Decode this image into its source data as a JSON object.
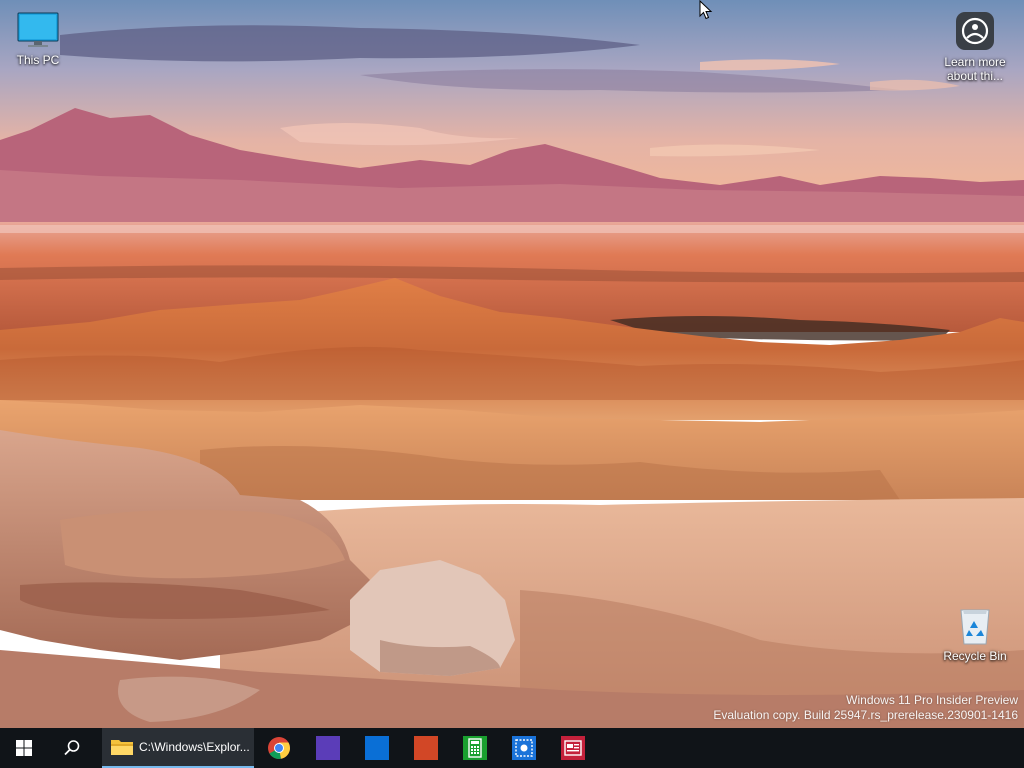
{
  "desktop": {
    "icons": {
      "this_pc": {
        "label": "This PC",
        "icon": "monitor-icon"
      },
      "learn_more": {
        "label": "Learn more about thi...",
        "icon": "learn-more-icon"
      },
      "recycle_bin": {
        "label": "Recycle Bin",
        "icon": "recycle-bin-icon"
      }
    },
    "watermark": {
      "line1": "Windows 11 Pro Insider Preview",
      "line2": "Evaluation copy. Build 25947.rs_prerelease.230901-1416"
    }
  },
  "taskbar": {
    "start": {
      "icon": "windows-logo-icon"
    },
    "search": {
      "icon": "search-icon"
    },
    "explorer": {
      "label": "C:\\Windows\\Explor...",
      "icon": "folder-icon",
      "active": true
    },
    "pinned": [
      {
        "icon": "chrome-icon",
        "color": "#4285f4"
      },
      {
        "icon": "purple-app-icon",
        "color": "#5b3db8"
      },
      {
        "icon": "blue-app-icon",
        "color": "#0a6fd6"
      },
      {
        "icon": "orange-app-icon",
        "color": "#d24726"
      },
      {
        "icon": "calculator-icon",
        "color": "#1aa02f"
      },
      {
        "icon": "snipping-tool-icon",
        "color": "#1a73d9"
      },
      {
        "icon": "news-app-icon",
        "color": "#c4213b"
      }
    ]
  },
  "colors": {
    "taskbar": "#101418",
    "accent": "#76b9ed"
  }
}
